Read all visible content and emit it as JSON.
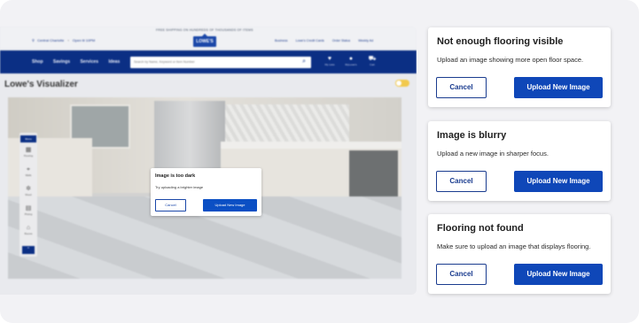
{
  "site": {
    "utility": {
      "free_shipping": "FREE SHIPPING ON HUNDREDS OF THOUSANDS OF ITEMS",
      "store_name": "Central Charlotte",
      "store_hours": "Open til 10PM",
      "right_links": [
        "Business",
        "Lowe's Credit Cards",
        "Order Status",
        "Weekly Ad"
      ]
    },
    "logo_text": "LOWE'S",
    "nav": {
      "links": [
        "Shop",
        "Savings",
        "Services",
        "Ideas"
      ],
      "search_placeholder": "Search by Name, Keyword or Item Number",
      "icons": [
        {
          "icon": "heart-icon",
          "label": "My Lists"
        },
        {
          "icon": "account-icon",
          "label": "MyLowe's"
        },
        {
          "icon": "cart-icon",
          "label": "Cart"
        }
      ],
      "cart_count": "0"
    },
    "visualizer_title": "Lowe's Visualizer",
    "tools": {
      "menu": "Menu",
      "items": [
        {
          "icon": "flooring-icon",
          "label": "Flooring"
        },
        {
          "icon": "walls-icon",
          "label": "Walls"
        },
        {
          "icon": "mood-icon",
          "label": "Mood"
        },
        {
          "icon": "pricing-icon",
          "label": "Pricing"
        },
        {
          "icon": "rooms-icon",
          "label": "Rooms"
        }
      ]
    },
    "dialog": {
      "title": "Image is too dark",
      "message": "Try uploading a brighter image",
      "cancel": "Cancel",
      "upload": "Upload New Image"
    }
  },
  "cards": [
    {
      "title": "Not enough flooring visible",
      "message": "Upload an image showing more open floor space.",
      "cancel": "Cancel",
      "upload": "Upload New Image"
    },
    {
      "title": "Image is blurry",
      "message": "Upload a new image in sharper focus.",
      "cancel": "Cancel",
      "upload": "Upload New Image"
    },
    {
      "title": "Flooring not found",
      "message": "Make sure to upload an image that displays flooring.",
      "cancel": "Cancel",
      "upload": "Upload New Image"
    }
  ],
  "colors": {
    "brand_blue": "#0b2f84",
    "button_blue": "#0f47b8",
    "background": "#f2f2f5"
  }
}
